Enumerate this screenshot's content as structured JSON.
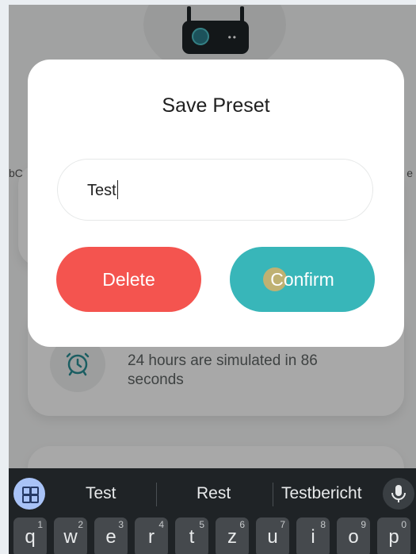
{
  "background": {
    "left_fragment": "bC",
    "right_fragment": "e",
    "simulation_text": "24 hours are simulated in 86 seconds"
  },
  "dialog": {
    "title": "Save Preset",
    "name_value": "Test",
    "delete_label": "Delete",
    "confirm_label": "Confirm"
  },
  "keyboard": {
    "suggestions": [
      "Test",
      "Rest",
      "Testbericht"
    ],
    "keys": [
      {
        "label": "q",
        "hint": "1"
      },
      {
        "label": "w",
        "hint": "2"
      },
      {
        "label": "e",
        "hint": "3"
      },
      {
        "label": "r",
        "hint": "4"
      },
      {
        "label": "t",
        "hint": "5"
      },
      {
        "label": "z",
        "hint": "6"
      },
      {
        "label": "u",
        "hint": "7"
      },
      {
        "label": "i",
        "hint": "8"
      },
      {
        "label": "o",
        "hint": "9"
      },
      {
        "label": "p",
        "hint": "0"
      }
    ]
  },
  "colors": {
    "delete": "#f4544f",
    "confirm": "#38b6b9",
    "keyboard_bg": "#1f2326"
  }
}
